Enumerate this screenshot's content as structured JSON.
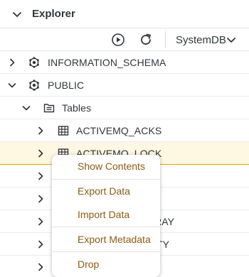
{
  "header": {
    "title": "Explorer",
    "collapse_icon": "chevron-down-icon"
  },
  "toolbar": {
    "run_icon": "play-circle-icon",
    "refresh_icon": "refresh-icon",
    "database_select": {
      "value": "SystemDB",
      "icon": "chevron-down-icon"
    }
  },
  "tree": {
    "schemas": [
      {
        "label": "INFORMATION_SCHEMA",
        "expanded": false,
        "icon": "schema-icon"
      },
      {
        "label": "PUBLIC",
        "expanded": true,
        "icon": "schema-icon"
      }
    ],
    "tables_folder": {
      "label": "Tables",
      "expanded": true,
      "icon": "tables-folder-icon"
    },
    "tables": [
      {
        "label": "ACTIVEMQ_ACKS",
        "icon": "table-grid-icon"
      },
      {
        "label": "ACTIVEMQ_LOCK",
        "icon": "table-grid-icon",
        "selected": true
      },
      {
        "label": "",
        "icon": "table-grid-icon"
      },
      {
        "label": "",
        "icon": "table-grid-icon"
      },
      {
        "label": "RAY",
        "icon": "table-grid-icon"
      },
      {
        "label": "TY",
        "icon": "table-grid-icon"
      },
      {
        "label": "",
        "icon": "table-grid-icon"
      }
    ]
  },
  "context_menu": {
    "items": [
      {
        "label": "Show Contents"
      },
      {
        "label": "Export Data"
      },
      {
        "label": "Import Data"
      },
      {
        "label": "Export Metadata"
      },
      {
        "label": "Drop"
      }
    ]
  },
  "colors": {
    "text": "#32363a",
    "menu_text": "#8c5c0c",
    "selected_row_bg": "#fef7e1",
    "selected_row_border": "#e9a700"
  }
}
